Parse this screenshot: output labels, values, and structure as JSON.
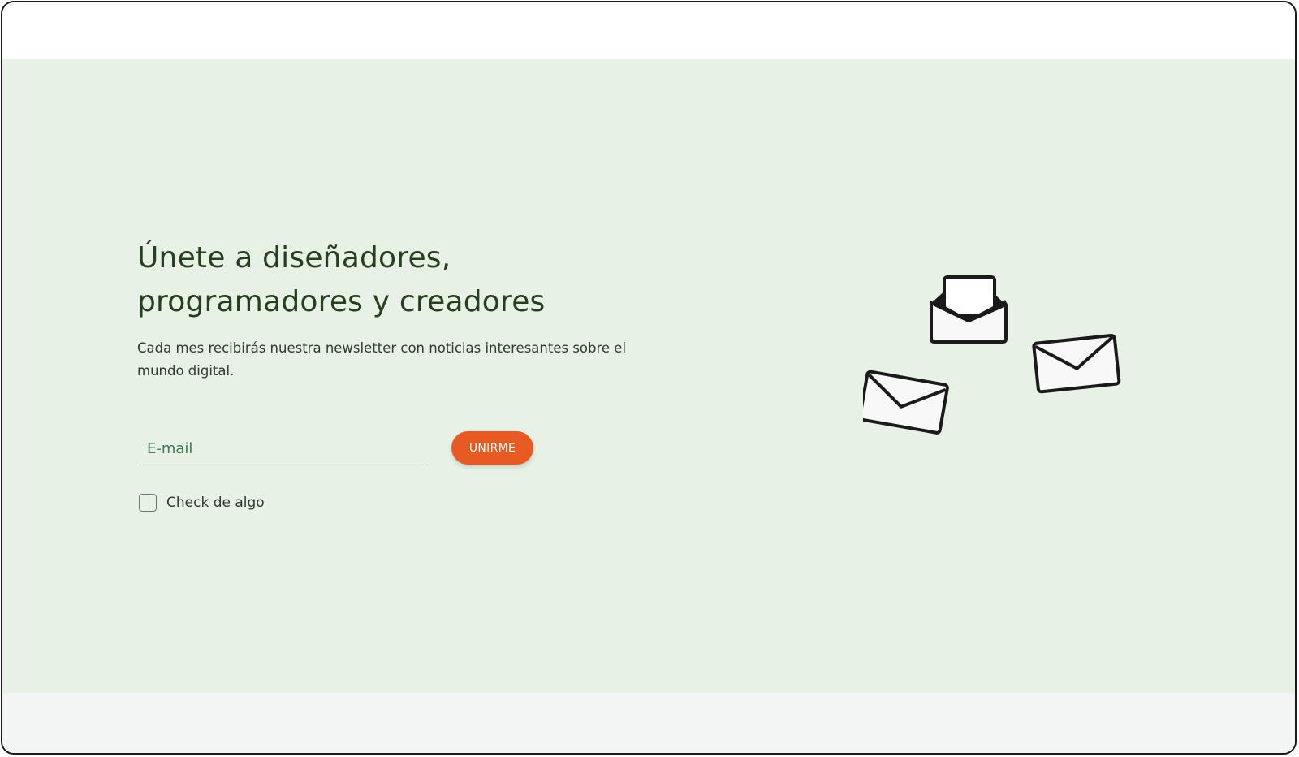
{
  "hero": {
    "title_line1": "Únete a diseñadores,",
    "title_line2": "programadores y creadores",
    "subtitle": "Cada mes recibirás nuestra newsletter con noticias interesantes  sobre el mundo digital."
  },
  "form": {
    "email_placeholder": "E-mail",
    "email_value": "",
    "button_label": "UNIRME",
    "checkbox_label": "Check de algo",
    "checkbox_checked": false
  },
  "illustration": {
    "icons": [
      "open-envelope-icon",
      "envelope-icon",
      "envelope-icon"
    ]
  },
  "colors": {
    "hero_bg": "#e7f1e5",
    "accent": "#e85a24",
    "heading": "#253f1f",
    "footer_bg": "#f3f5f5"
  }
}
